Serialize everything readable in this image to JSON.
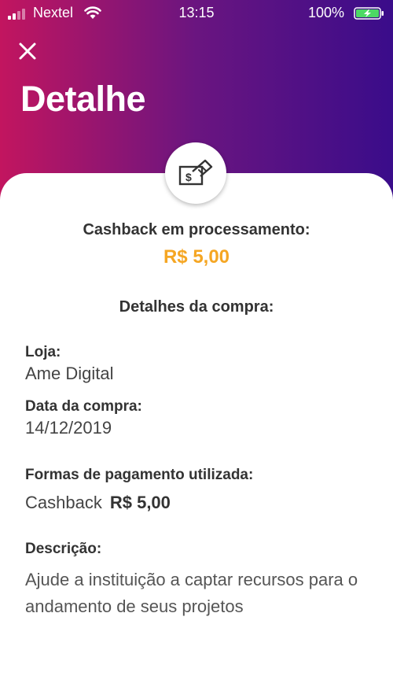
{
  "status_bar": {
    "carrier": "Nextel",
    "time": "13:15",
    "battery_percent": "100%",
    "signal_bars": 2,
    "signal_bars_total": 4
  },
  "header": {
    "title": "Detalhe",
    "close_icon": "close-icon",
    "gradient_colors": [
      "#c2155f",
      "#6a1580",
      "#3a0c8a"
    ]
  },
  "badge_icon": "cashback-card-icon",
  "cashback": {
    "label": "Cashback em processamento:",
    "value": "R$ 5,00",
    "value_color": "#f5a623"
  },
  "purchase": {
    "title": "Detalhes da compra:",
    "store_label": "Loja:",
    "store_value": "Ame Digital",
    "date_label": "Data da compra:",
    "date_value": "14/12/2019"
  },
  "payment": {
    "label": "Formas de pagamento utilizada:",
    "method": "Cashback",
    "amount": "R$ 5,00"
  },
  "description": {
    "label": "Descrição:",
    "text": "Ajude a instituição a captar recursos para o andamento de seus projetos"
  }
}
